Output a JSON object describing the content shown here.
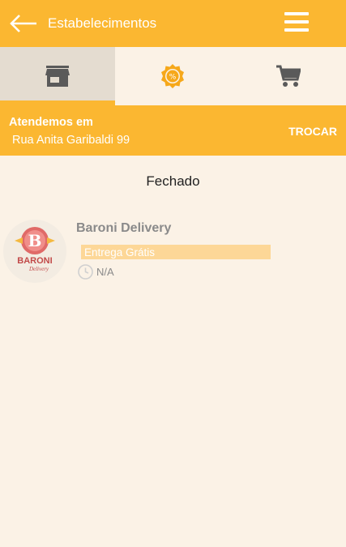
{
  "appbar": {
    "title": "Estabelecimentos",
    "back_icon": "arrow-left-icon",
    "menu_icon": "hamburger-menu-icon"
  },
  "tabs": [
    {
      "icon": "store-icon",
      "active": true
    },
    {
      "icon": "discount-badge-icon",
      "active": false
    },
    {
      "icon": "shopping-cart-icon",
      "active": false
    }
  ],
  "address": {
    "label": "Atendemos em",
    "street": "Rua Anita Garibaldi 99",
    "swap_label": "TROCAR"
  },
  "status": "Fechado",
  "stores": [
    {
      "name": "Baroni Delivery",
      "logo_text": "BARONI",
      "logo_sub": "Delivery",
      "logo_letter": "B",
      "delivery_tag": "Entrega Grátis",
      "hours": "N/A",
      "hours_icon": "clock-icon"
    }
  ],
  "colors": {
    "accent": "#fbb731",
    "background": "#fbf2e6",
    "active_tab": "#e4dcd0",
    "icon_gray": "#5a5a5a",
    "tag_bg": "#fdd797"
  }
}
